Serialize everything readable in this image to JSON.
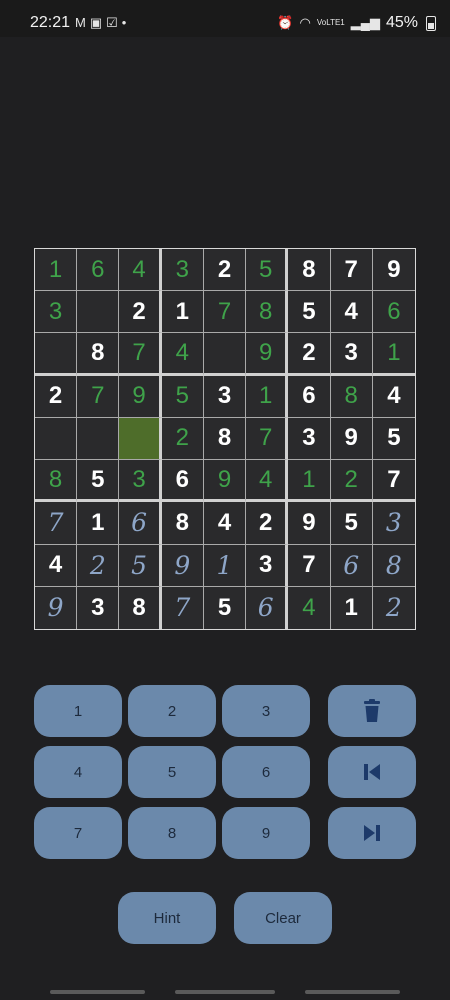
{
  "status_bar": {
    "time": "22:21",
    "left_icons": [
      "gmail-icon",
      "outlook-icon",
      "check-icon",
      "dot-icon"
    ],
    "right_icons": [
      "alarm-icon",
      "wifi-icon",
      "volte-icon",
      "signal-icon"
    ],
    "volte_label": "VoLTE1",
    "battery": "45%"
  },
  "board": {
    "cells": [
      [
        "1",
        "6",
        "4",
        "3",
        "2",
        "5",
        "8",
        "7",
        "9"
      ],
      [
        "3",
        "",
        "2",
        "1",
        "7",
        "8",
        "5",
        "4",
        "6"
      ],
      [
        "",
        "8",
        "7",
        "4",
        "",
        "9",
        "2",
        "3",
        "1"
      ],
      [
        "2",
        "7",
        "9",
        "5",
        "3",
        "1",
        "6",
        "8",
        "4"
      ],
      [
        "",
        "",
        "",
        "2",
        "8",
        "7",
        "3",
        "9",
        "5"
      ],
      [
        "8",
        "5",
        "3",
        "6",
        "9",
        "4",
        "1",
        "2",
        "7"
      ],
      [
        "7",
        "1",
        "6",
        "8",
        "4",
        "2",
        "9",
        "5",
        "3"
      ],
      [
        "4",
        "2",
        "5",
        "9",
        "1",
        "3",
        "7",
        "6",
        "8"
      ],
      [
        "9",
        "3",
        "8",
        "7",
        "5",
        "6",
        "4",
        "1",
        "2"
      ]
    ],
    "styles": [
      [
        "correct",
        "correct",
        "correct",
        "correct",
        "given",
        "correct",
        "given",
        "given",
        "given"
      ],
      [
        "correct",
        "empty",
        "given",
        "given",
        "correct",
        "correct",
        "given",
        "given",
        "correct"
      ],
      [
        "empty",
        "given",
        "correct",
        "correct",
        "empty",
        "correct",
        "given",
        "given",
        "correct"
      ],
      [
        "given",
        "correct",
        "correct",
        "correct",
        "given",
        "correct",
        "given",
        "correct",
        "given"
      ],
      [
        "empty",
        "empty",
        "selected",
        "correct",
        "given",
        "correct",
        "given",
        "given",
        "given"
      ],
      [
        "correct",
        "given",
        "correct",
        "given",
        "correct",
        "correct",
        "correct",
        "correct",
        "given"
      ],
      [
        "pencil",
        "given",
        "pencil",
        "given",
        "given",
        "given",
        "given",
        "given",
        "pencil"
      ],
      [
        "given",
        "pencil",
        "pencil",
        "pencil",
        "pencil",
        "given",
        "given",
        "pencil",
        "pencil"
      ],
      [
        "pencil",
        "given",
        "given",
        "pencil",
        "given",
        "pencil",
        "correct",
        "given",
        "pencil"
      ]
    ],
    "colors": {
      "given": "#ffffff",
      "correct": "#3fa34a",
      "pencil": "#8ea6c8",
      "selected_bg": "#4e6d2a"
    }
  },
  "keypad": {
    "numbers": [
      "1",
      "2",
      "3",
      "4",
      "5",
      "6",
      "7",
      "8",
      "9"
    ],
    "actions": [
      "trash-icon",
      "skip-previous-icon",
      "skip-next-icon"
    ]
  },
  "buttons": {
    "hint": "Hint",
    "clear": "Clear"
  },
  "accent": "#6b89ab"
}
